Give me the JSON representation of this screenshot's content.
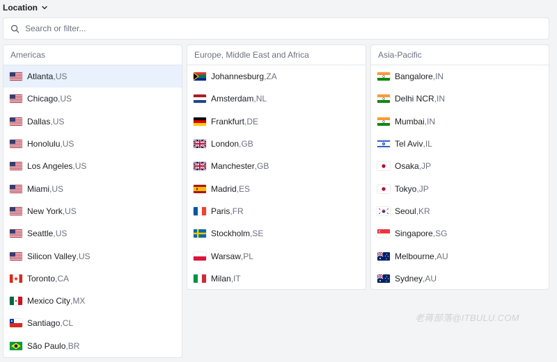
{
  "header": {
    "title": "Location"
  },
  "search": {
    "placeholder": "Search or filter..."
  },
  "regions": [
    {
      "title": "Americas",
      "cities": [
        {
          "name": "Atlanta",
          "code": "US",
          "flag": "us",
          "selected": true
        },
        {
          "name": "Chicago",
          "code": "US",
          "flag": "us"
        },
        {
          "name": "Dallas",
          "code": "US",
          "flag": "us"
        },
        {
          "name": "Honolulu",
          "code": "US",
          "flag": "us"
        },
        {
          "name": "Los Angeles",
          "code": "US",
          "flag": "us"
        },
        {
          "name": "Miami",
          "code": "US",
          "flag": "us"
        },
        {
          "name": "New York",
          "code": "US",
          "flag": "us"
        },
        {
          "name": "Seattle",
          "code": "US",
          "flag": "us"
        },
        {
          "name": "Silicon Valley",
          "code": "US",
          "flag": "us"
        },
        {
          "name": "Toronto",
          "code": "CA",
          "flag": "ca"
        },
        {
          "name": "Mexico City",
          "code": "MX",
          "flag": "mx"
        },
        {
          "name": "Santiago",
          "code": "CL",
          "flag": "cl"
        },
        {
          "name": "São Paulo",
          "code": "BR",
          "flag": "br"
        }
      ]
    },
    {
      "title": "Europe, Middle East and Africa",
      "cities": [
        {
          "name": "Johannesburg",
          "code": "ZA",
          "flag": "za"
        },
        {
          "name": "Amsterdam",
          "code": "NL",
          "flag": "nl"
        },
        {
          "name": "Frankfurt",
          "code": "DE",
          "flag": "de"
        },
        {
          "name": "London",
          "code": "GB",
          "flag": "gb"
        },
        {
          "name": "Manchester",
          "code": "GB",
          "flag": "gb"
        },
        {
          "name": "Madrid",
          "code": "ES",
          "flag": "es"
        },
        {
          "name": "Paris",
          "code": "FR",
          "flag": "fr"
        },
        {
          "name": "Stockholm",
          "code": "SE",
          "flag": "se"
        },
        {
          "name": "Warsaw",
          "code": "PL",
          "flag": "pl"
        },
        {
          "name": "Milan",
          "code": "IT",
          "flag": "it"
        }
      ]
    },
    {
      "title": "Asia-Pacific",
      "cities": [
        {
          "name": "Bangalore",
          "code": "IN",
          "flag": "in"
        },
        {
          "name": "Delhi NCR",
          "code": "IN",
          "flag": "in"
        },
        {
          "name": "Mumbai",
          "code": "IN",
          "flag": "in"
        },
        {
          "name": "Tel Aviv",
          "code": "IL",
          "flag": "il"
        },
        {
          "name": "Osaka",
          "code": "JP",
          "flag": "jp"
        },
        {
          "name": "Tokyo",
          "code": "JP",
          "flag": "jp"
        },
        {
          "name": "Seoul",
          "code": "KR",
          "flag": "kr"
        },
        {
          "name": "Singapore",
          "code": "SG",
          "flag": "sg"
        },
        {
          "name": "Melbourne",
          "code": "AU",
          "flag": "au"
        },
        {
          "name": "Sydney",
          "code": "AU",
          "flag": "au"
        }
      ]
    }
  ],
  "colors": {
    "selected_row": "#e8f1fc",
    "muted_text": "#6b7280",
    "border": "#e3e5e8"
  },
  "watermark": "老蒋部落@ITBULU.COM"
}
